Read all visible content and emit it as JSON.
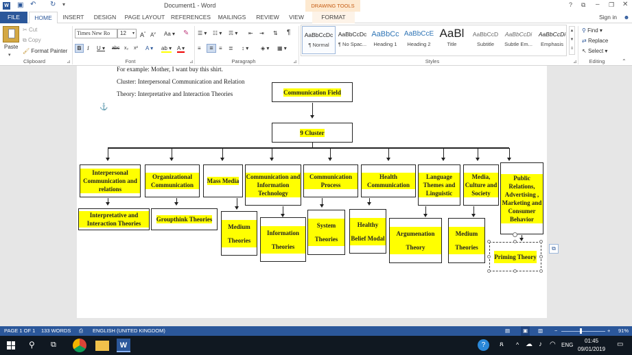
{
  "titlebar": {
    "title": "Document1 - Word",
    "context_group": "DRAWING TOOLS",
    "help": "?",
    "window_controls": [
      "restore-down",
      "minimize",
      "maximize",
      "close"
    ]
  },
  "tabs": [
    "FILE",
    "HOME",
    "INSERT",
    "DESIGN",
    "PAGE LAYOUT",
    "REFERENCES",
    "MAILINGS",
    "REVIEW",
    "VIEW",
    "FORMAT"
  ],
  "signin": "Sign in",
  "clipboard": {
    "paste": "Paste",
    "cut": "Cut",
    "copy": "Copy",
    "format_painter": "Format Painter",
    "label": "Clipboard"
  },
  "font": {
    "family": "Times New Ro",
    "size": "12",
    "label": "Font"
  },
  "paragraph": {
    "label": "Paragraph"
  },
  "styles": {
    "label": "Styles",
    "items": [
      {
        "preview": "AaBbCcDc",
        "name": "¶ Normal"
      },
      {
        "preview": "AaBbCcDc",
        "name": "¶ No Spac..."
      },
      {
        "preview": "AaBbCc",
        "name": "Heading 1"
      },
      {
        "preview": "AaBbCcE",
        "name": "Heading 2"
      },
      {
        "preview": "AaBl",
        "name": "Title"
      },
      {
        "preview": "AaBbCcD",
        "name": "Subtitle"
      },
      {
        "preview": "AaBbCcDi",
        "name": "Subtle Em..."
      },
      {
        "preview": "AaBbCcDi",
        "name": "Emphasis"
      }
    ]
  },
  "editing": {
    "find": "Find",
    "replace": "Replace",
    "select": "Select",
    "label": "Editing"
  },
  "document": {
    "lines": [
      "For example: Mother, I want buy this shirt.",
      "Cluster: Interpersonal Communication and Relation",
      "Theory: Interpretative and Interaction Theories"
    ],
    "chart": {
      "root": "Communication Field",
      "cluster": "9 Cluster",
      "clusters": [
        "Interpersonal Communication and relations",
        "Organizational Communication",
        "Mass Media",
        "Communication and Information Technology",
        "Communication Process",
        "Health Communication",
        "Language Themes and Linguistic",
        "Media, Culture and Society",
        "Public Relations, Advertising , Marketing and Consumer Behavior"
      ],
      "theories": [
        "Interpretative and Interaction Theories",
        "Groupthink Theories",
        "Medium Theories",
        "Information Theories",
        "System Theories",
        "Healthy Belief Modal",
        "Argumenation Theory",
        "Medium Theories",
        "Priming Theory"
      ]
    }
  },
  "status": {
    "page": "PAGE 1 OF 1",
    "words": "133 WORDS",
    "language": "ENGLISH (UNITED KINGDOM)",
    "zoom": "91%"
  },
  "taskbar": {
    "lang": "ENG",
    "time": "01:45",
    "date": "09/01/2019"
  }
}
